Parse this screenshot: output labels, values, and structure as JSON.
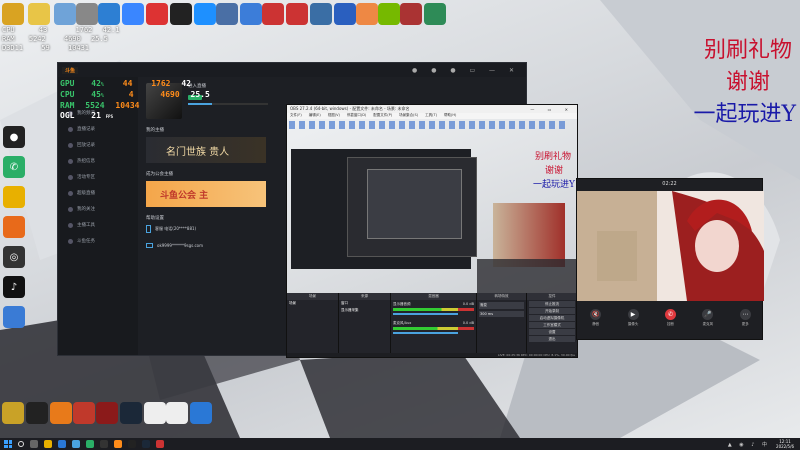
{
  "overlay_top": {
    "cpu_label": "CPU",
    "ram_label": "RAM",
    "d3d_label": "D3D11",
    "cpu_val": "43",
    "ram_val": "5242",
    "d3d_val": "59",
    "row1_b": "1762",
    "row1_c": "42.1",
    "row2_b": "4690",
    "row2_c": "25.5",
    "row3_b": "10431"
  },
  "overlay_app": {
    "gpu_label": "GPU",
    "cpu_label": "CPU",
    "ram_label": "RAM",
    "ogl_label": "OGL",
    "gpu_pct": "42",
    "cpu_pct": "45",
    "ram_used": "5524",
    "ogl_fps": "21",
    "fps_unit": "FPS",
    "gpu_b": "44",
    "gpu_c": "1762",
    "gpu_d": "42",
    "cpu_b": "4",
    "cpu_c": "4690",
    "cpu_d": "25.5",
    "ram_b": "10434"
  },
  "overlay_message": {
    "line1": "别刷礼物",
    "line2": "谢谢",
    "line3": "一起玩进Y"
  },
  "app_window": {
    "logo": "斗鱼",
    "profile_name": "进入直播",
    "side_items": [
      "我的频道",
      "直播记录",
      "回放记录",
      "热招信息",
      "活动专区",
      "超级直播",
      "我的关注",
      "主播工具",
      "斗鱼任务"
    ],
    "section_live": "我的主播",
    "banner_text": "名门世族 贵人",
    "section_union": "成为公会主播",
    "union_banner": "斗鱼公会 主",
    "section_help": "帮助设置",
    "help_row1": "客服 电话(20****881)",
    "help_row2": "ok9999******9sgs.com"
  },
  "obs_window": {
    "title": "OBS 27.2.4 (64-bit, windows) - 配置文件: 未命名 - 场景: 未命名",
    "menu": [
      "文件(F)",
      "编辑(E)",
      "视图(V)",
      "停靠窗口(D)",
      "配置文件(P)",
      "场景集合(S)",
      "工具(T)",
      "帮助(H)"
    ],
    "preview_msg_1": "别刷礼物",
    "preview_msg_2": "谢谢",
    "preview_msg_3": "一起玩进Y",
    "dock_scenes": "场景",
    "dock_sources": "来源",
    "dock_mixer": "混音器",
    "dock_transitions": "转场特效",
    "dock_controls": "控件",
    "scene_item": "场景",
    "source_1": "窗口",
    "source_2": "显示器采集",
    "mixer_1": "显示器音频",
    "mixer_2": "麦克风/Aux",
    "mixer_db_1": "0.0 dB",
    "mixer_db_2": "0.0 dB",
    "transition": "渐变",
    "duration": "300 ms",
    "controls": [
      "停止推流",
      "开始录制",
      "启动虚拟摄像机",
      "工作室模式",
      "设置",
      "退出"
    ],
    "status": "LIVE: 00:25:36   REC: 00:00:00   CPU: 8.1%, 30.00 fps"
  },
  "call_window": {
    "time": "02:22",
    "buttons": [
      "静音",
      "摄像头",
      "挂断",
      "麦克风",
      "更多"
    ]
  },
  "taskbar": {
    "time": "12:11",
    "date": "2022/5/6"
  },
  "colors": {
    "overlay_green": "#39c46b",
    "overlay_orange": "#ff8c1a",
    "overlay_red": "#c8102e",
    "overlay_blue": "#1a1aa8",
    "hangup_red": "#e0393e"
  }
}
